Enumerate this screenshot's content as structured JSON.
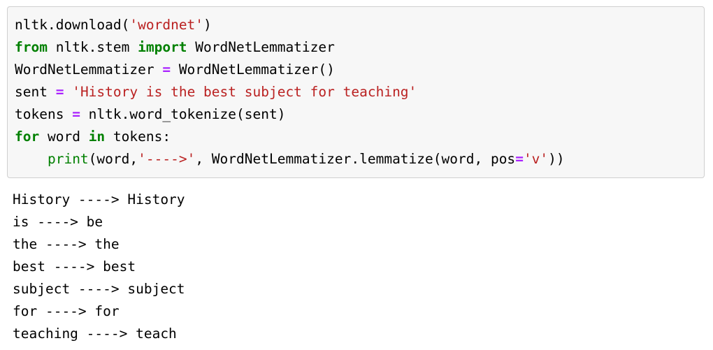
{
  "cell": {
    "background_color": "#f7f7f7",
    "border_color": "#cfcfcf",
    "colors": {
      "keyword": "#008000",
      "builtin_function": "#008000",
      "string": "#BA2121",
      "operator": "#AA22FF",
      "text": "#000000",
      "page_background": "#ffffff"
    },
    "code": {
      "lines": [
        {
          "index": 1,
          "text": "nltk.download('wordnet')",
          "tokens": [
            {
              "t": "nltk.download(",
              "c": "plain"
            },
            {
              "t": "'wordnet'",
              "c": "str"
            },
            {
              "t": ")",
              "c": "plain"
            }
          ]
        },
        {
          "index": 2,
          "text": "from nltk.stem import WordNetLemmatizer",
          "tokens": [
            {
              "t": "from",
              "c": "kw"
            },
            {
              "t": " nltk.stem ",
              "c": "plain"
            },
            {
              "t": "import",
              "c": "kw"
            },
            {
              "t": " WordNetLemmatizer",
              "c": "plain"
            }
          ]
        },
        {
          "index": 3,
          "text": "WordNetLemmatizer = WordNetLemmatizer()",
          "tokens": [
            {
              "t": "WordNetLemmatizer ",
              "c": "plain"
            },
            {
              "t": "=",
              "c": "op"
            },
            {
              "t": " WordNetLemmatizer()",
              "c": "plain"
            }
          ]
        },
        {
          "index": 4,
          "text": "sent = 'History is the best subject for teaching'",
          "tokens": [
            {
              "t": "sent ",
              "c": "plain"
            },
            {
              "t": "=",
              "c": "op"
            },
            {
              "t": " ",
              "c": "plain"
            },
            {
              "t": "'History is the best subject for teaching'",
              "c": "str"
            }
          ]
        },
        {
          "index": 5,
          "text": "tokens = nltk.word_tokenize(sent)",
          "tokens": [
            {
              "t": "tokens ",
              "c": "plain"
            },
            {
              "t": "=",
              "c": "op"
            },
            {
              "t": " nltk.word_tokenize(sent)",
              "c": "plain"
            }
          ]
        },
        {
          "index": 6,
          "text": "for word in tokens:",
          "tokens": [
            {
              "t": "for",
              "c": "kw"
            },
            {
              "t": " word ",
              "c": "plain"
            },
            {
              "t": "in",
              "c": "kw"
            },
            {
              "t": " tokens:",
              "c": "plain"
            }
          ]
        },
        {
          "index": 7,
          "text": "    print(word,'---->', WordNetLemmatizer.lemmatize(word, pos='v'))",
          "tokens": [
            {
              "t": "    ",
              "c": "plain"
            },
            {
              "t": "print",
              "c": "fn"
            },
            {
              "t": "(word,",
              "c": "plain"
            },
            {
              "t": "'---->'",
              "c": "str"
            },
            {
              "t": ", WordNetLemmatizer.lemmatize(word, pos",
              "c": "plain"
            },
            {
              "t": "=",
              "c": "op"
            },
            {
              "t": "'v'",
              "c": "str"
            },
            {
              "t": "))",
              "c": "plain"
            }
          ]
        }
      ]
    }
  },
  "output": {
    "lines": [
      "History ----> History",
      "is ----> be",
      "the ----> the",
      "best ----> best",
      "subject ----> subject",
      "for ----> for",
      "teaching ----> teach"
    ],
    "pairs": [
      {
        "token": "History",
        "lemma": "History"
      },
      {
        "token": "is",
        "lemma": "be"
      },
      {
        "token": "the",
        "lemma": "the"
      },
      {
        "token": "best",
        "lemma": "best"
      },
      {
        "token": "subject",
        "lemma": "subject"
      },
      {
        "token": "for",
        "lemma": "for"
      },
      {
        "token": "teaching",
        "lemma": "teach"
      }
    ]
  }
}
